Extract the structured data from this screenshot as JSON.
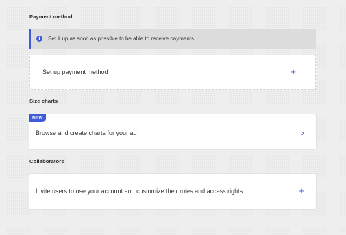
{
  "payment": {
    "title": "Payment method",
    "notice": "Set it up as soon as possible to be able to receive payments",
    "setup_label": "Set up payment method",
    "setup_action": "+"
  },
  "size_charts": {
    "title": "Size charts",
    "badge": "NEW",
    "browse_label": "Browse and create charts for your ad",
    "browse_action": "›"
  },
  "collaborators": {
    "title": "Collaborators",
    "invite_label": "Invite users to use your account and customize their roles and access rights",
    "invite_action": "+"
  },
  "icons": {
    "notice_icon": "info-icon",
    "add_icon": "plus-icon",
    "chevron_icon": "chevron-right-icon"
  },
  "colors": {
    "accent": "#3f5bd6",
    "notice_bg": "#dcdcdc",
    "page_bg": "#eeeeee"
  }
}
